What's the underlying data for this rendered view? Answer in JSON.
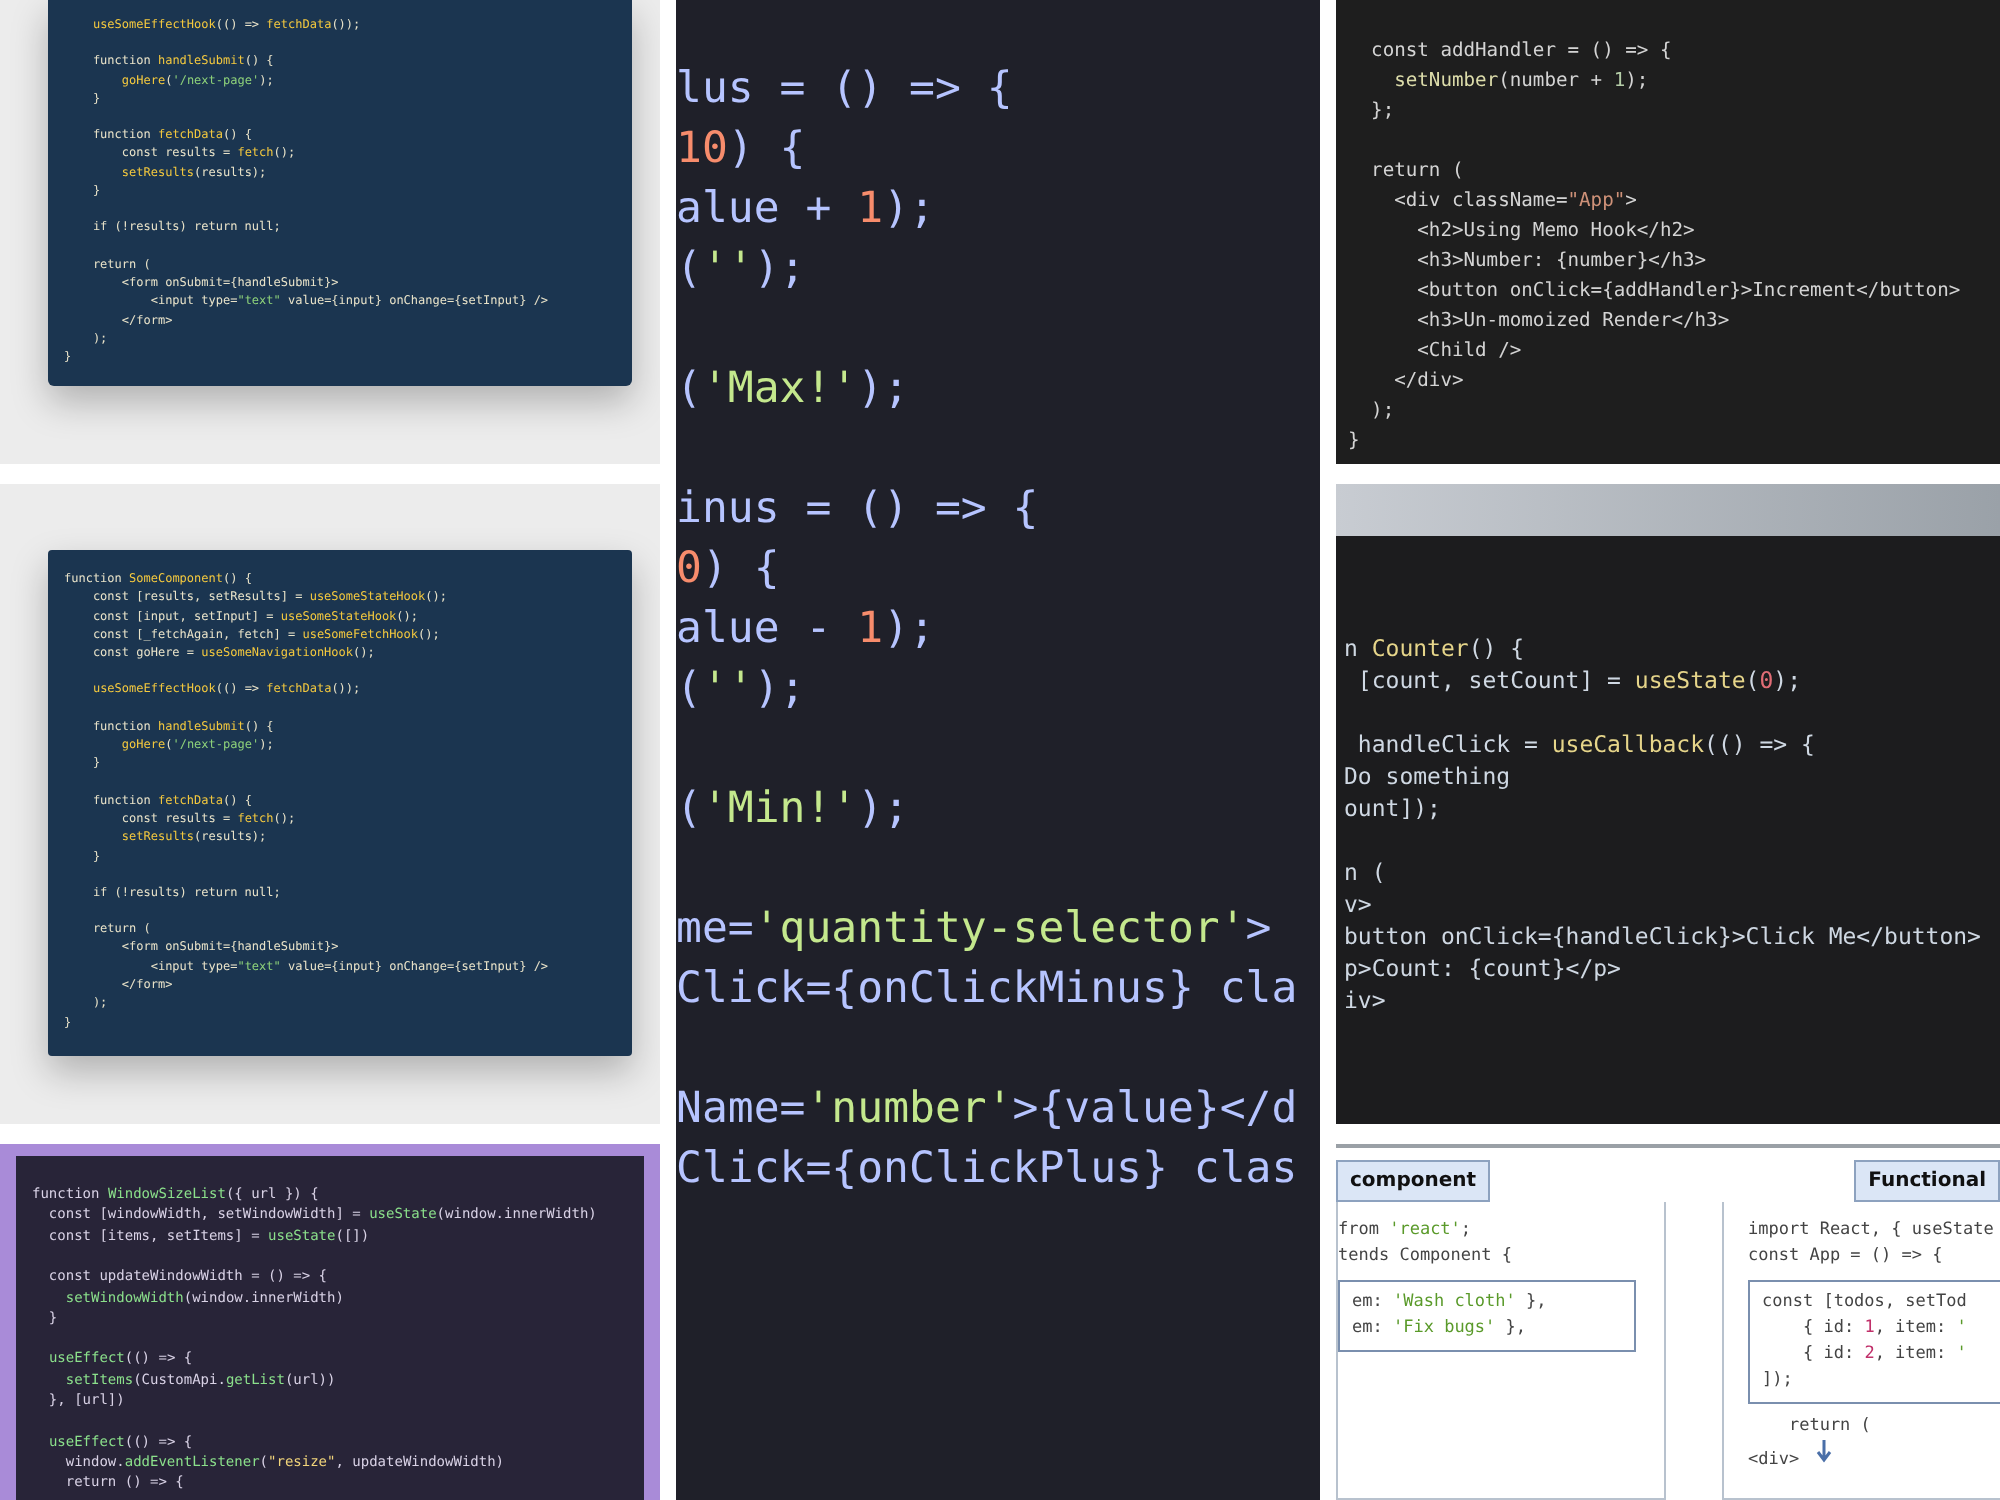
{
  "columns": [
    {
      "tiles": [
        {
          "kind": "navy-card-cropped",
          "blocks": [
            [
              "    useSomeEffectHook(() => fetchData());"
            ],
            [
              "    function handleSubmit() {",
              "        goHere('/next-page');",
              "    }"
            ],
            [
              "    function fetchData() {",
              "        const results = fetch();",
              "        setResults(results);",
              "    }"
            ],
            [
              "    if (!results) return null;"
            ],
            [
              "    return (",
              "        <form onSubmit={handleSubmit}>",
              "            <input type=\"text\" value={input} onChange={setInput} />",
              "        </form>",
              "    );",
              "}"
            ]
          ]
        },
        {
          "kind": "navy-card",
          "blocks": [
            [
              "function SomeComponent() {",
              "    const [results, setResults] = useSomeStateHook();",
              "    const [input, setInput] = useSomeStateHook();",
              "    const [_fetchAgain, fetch] = useSomeFetchHook();",
              "    const goHere = useSomeNavigationHook();"
            ],
            [
              "    useSomeEffectHook(() => fetchData());"
            ],
            [
              "    function handleSubmit() {",
              "        goHere('/next-page');",
              "    }"
            ],
            [
              "    function fetchData() {",
              "        const results = fetch();",
              "        setResults(results);",
              "    }"
            ],
            [
              "    if (!results) return null;"
            ],
            [
              "    return (",
              "        <form onSubmit={handleSubmit}>",
              "            <input type=\"text\" value={input} onChange={setInput} />",
              "        </form>",
              "    );",
              "}"
            ]
          ]
        },
        {
          "kind": "purple-card",
          "blocks": [
            [
              "function WindowSizeList({ url }) {",
              "  const [windowWidth, setWindowWidth] = useState(window.innerWidth)",
              "  const [items, setItems] = useState([])"
            ],
            [
              "  const updateWindowWidth = () => {",
              "    setWindowWidth(window.innerWidth)",
              "  }"
            ],
            [
              "  useEffect(() => {",
              "    setItems(CustomApi.getList(url))",
              "  }, [url])"
            ],
            [
              "  useEffect(() => {",
              "    window.addEventListener(\"resize\", updateWindowWidth)",
              "    return () => {"
            ]
          ]
        }
      ]
    },
    {
      "tiles": [
        {
          "kind": "large-editor",
          "blocks": [
            [
              "lus = () => {",
              "10) {",
              "alue + 1);",
              "('');"
            ],
            [
              "('Max!');"
            ],
            [
              "inus = () => {",
              "0) {",
              "alue - 1);",
              "('');"
            ],
            [
              "('Min!');"
            ],
            [
              "me='quantity-selector'>",
              "Click={onClickMinus} cla"
            ],
            [
              "Name='number'>{value}</d",
              "Click={onClickPlus} clas"
            ]
          ]
        }
      ]
    },
    {
      "tiles": [
        {
          "kind": "dark-editor",
          "blocks": [
            [
              "  const addHandler = () => {",
              "    setNumber(number + 1);",
              "  };"
            ],
            [
              "  return (",
              "    <div className=\"App\">",
              "      <h2>Using Memo Hook</h2>",
              "      <h3>Number: {number}</h3>",
              "      <button onClick={addHandler}>Increment</button>",
              "      <h3>Un-momoized Render</h3>",
              "      <Child />",
              "    </div>",
              "  );",
              "}"
            ]
          ]
        },
        {
          "kind": "banner-editor",
          "blocks": [
            [
              "n Counter() {",
              " [count, setCount] = useState(0);"
            ],
            [
              " handleClick = useCallback(() => {",
              "Do something",
              "ount]);"
            ],
            [
              "n (",
              "v>",
              "button onClick={handleClick}>Click Me</button>",
              "p>Count: {count}</p>",
              "iv>"
            ]
          ]
        },
        {
          "kind": "diagram",
          "panels": [
            {
              "header": "component",
              "above": [
                "from 'react';",
                "tends Component {"
              ],
              "boxed": [
                "em: 'Wash cloth' },",
                "em: 'Fix bugs' },"
              ]
            },
            {
              "header": "Functional",
              "above": [
                "import React, { useState",
                "const App = () => {"
              ],
              "boxed": [
                "const [todos, setTod",
                "    { id: 1, item: '",
                "    { id: 2, item: '",
                "]);"
              ],
              "below": [
                "    return (",
                "<div>"
              ]
            }
          ]
        }
      ]
    }
  ]
}
